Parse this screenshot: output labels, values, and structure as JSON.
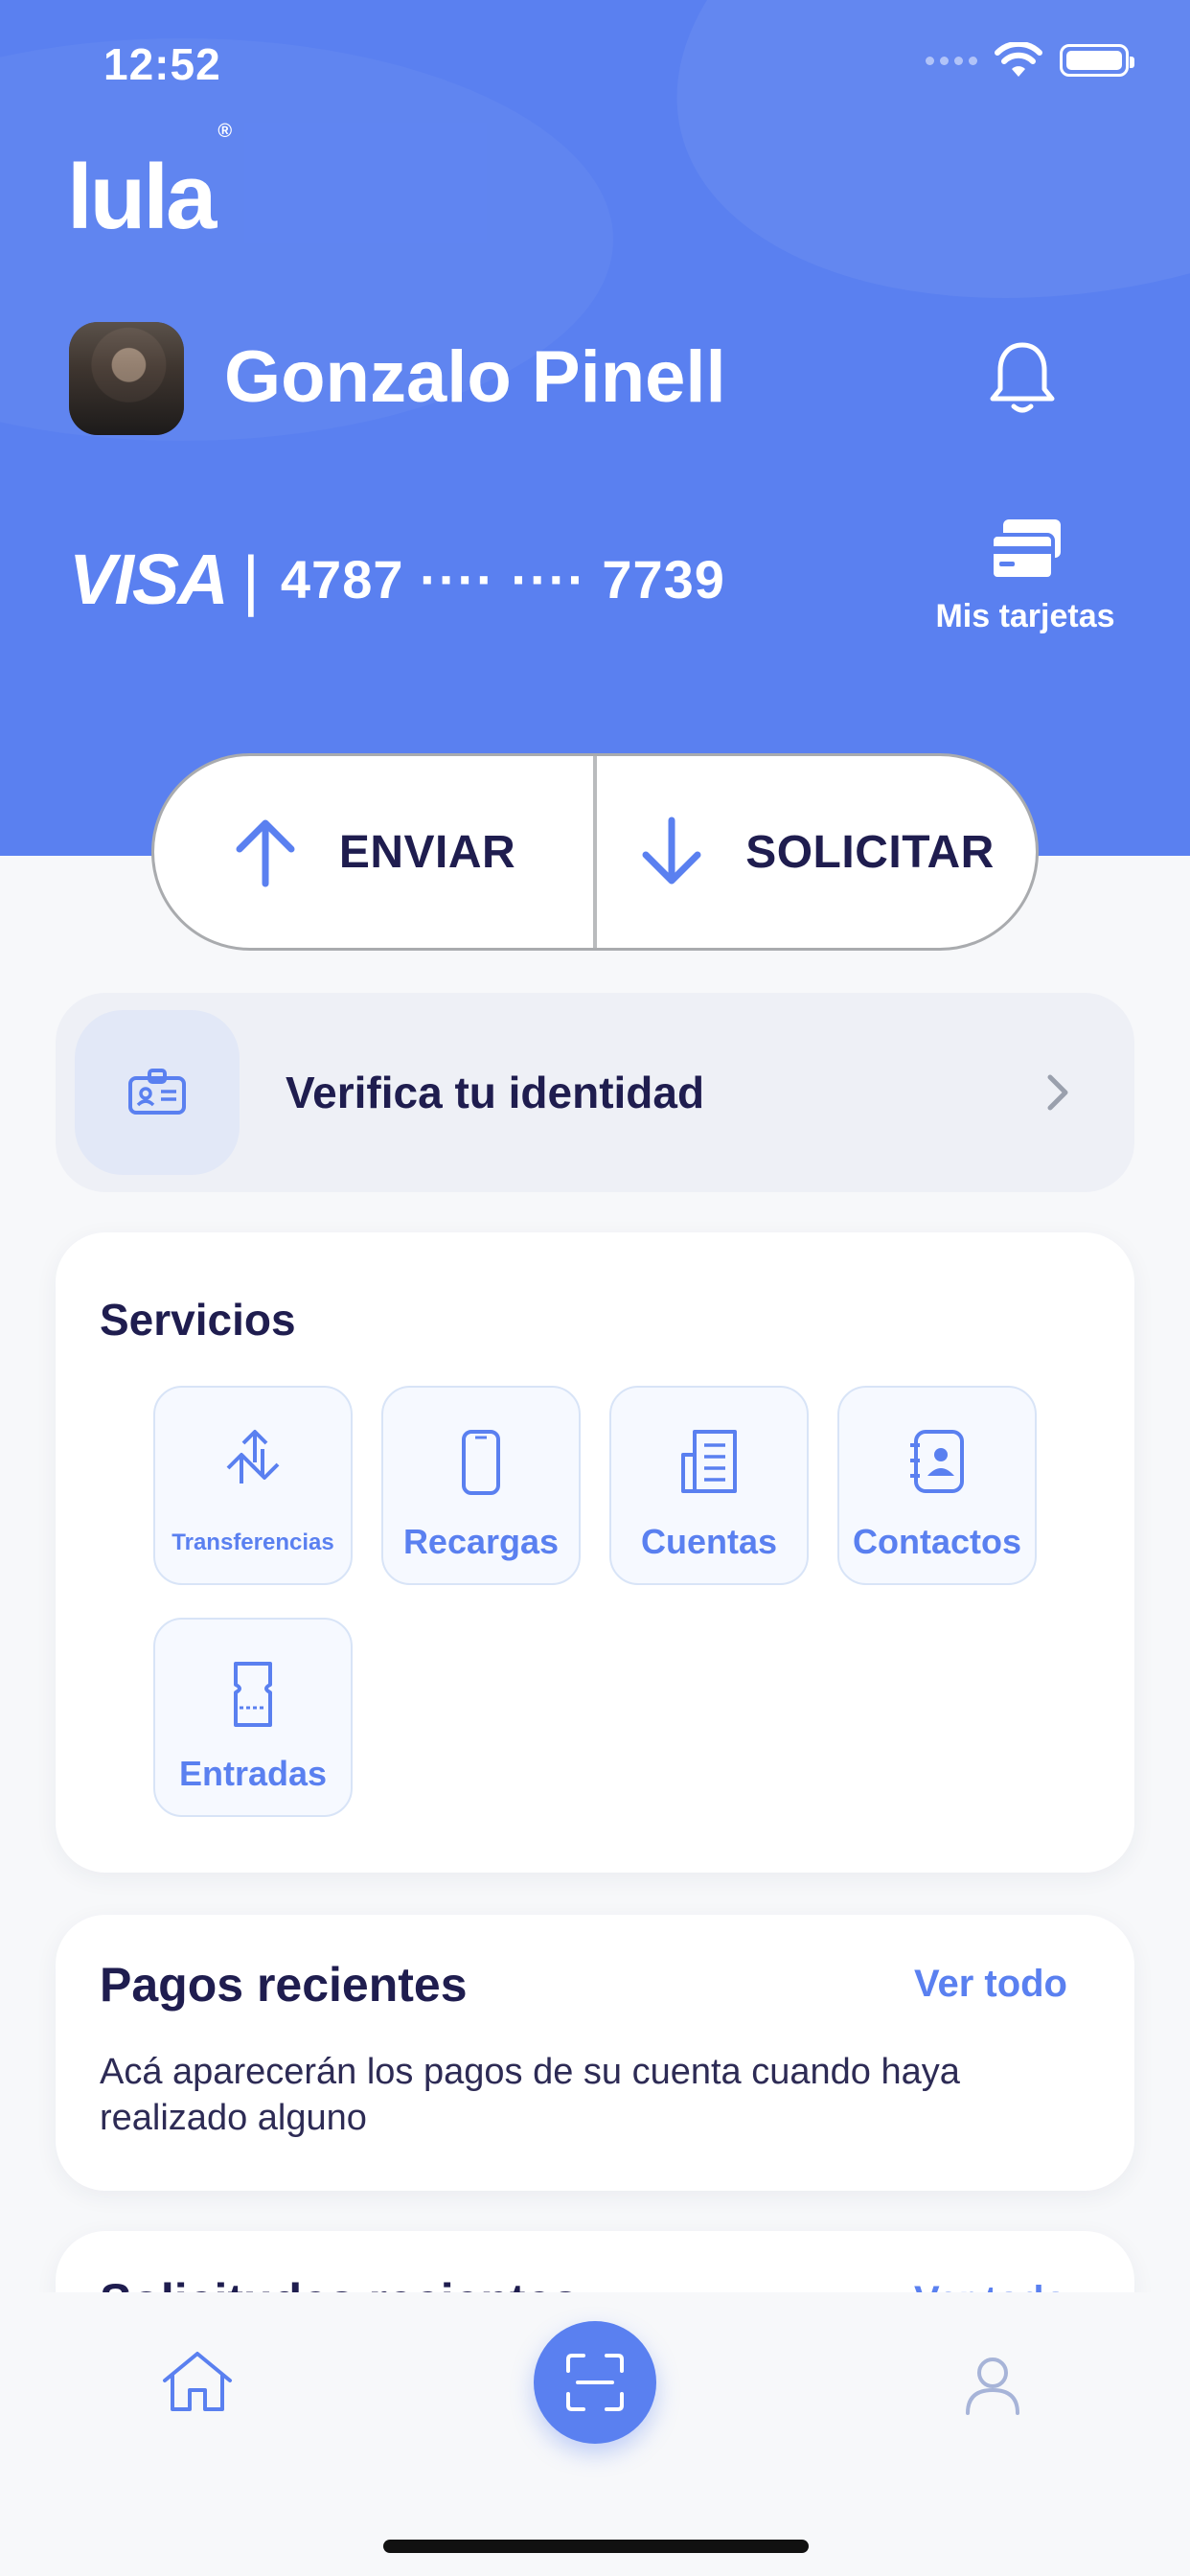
{
  "status_bar": {
    "time": "12:52"
  },
  "header": {
    "brand": "lula",
    "brand_mark": "®",
    "user_name": "Gonzalo Pinell",
    "notification_icon": "bell-icon"
  },
  "card": {
    "network": "VISA",
    "separator": "|",
    "number_masked": "4787 ···· ···· 7739",
    "my_cards_label": "Mis tarjetas",
    "my_cards_icon": "cards-icon"
  },
  "actions": {
    "send_label": "ENVIAR",
    "request_label": "SOLICITAR"
  },
  "verify": {
    "label": "Verifica tu identidad",
    "icon": "id-card-icon"
  },
  "services": {
    "title": "Servicios",
    "items": [
      {
        "label": "Transferencias",
        "icon": "transfer-icon"
      },
      {
        "label": "Recargas",
        "icon": "phone-icon"
      },
      {
        "label": "Cuentas",
        "icon": "bill-icon"
      },
      {
        "label": "Contactos",
        "icon": "contacts-icon"
      },
      {
        "label": "Entradas",
        "icon": "ticket-icon"
      }
    ]
  },
  "recent_payments": {
    "title": "Pagos recientes",
    "see_all": "Ver todo",
    "empty_message": "Acá aparecerán los pagos de su cuenta cuando haya realizado alguno"
  },
  "recent_requests": {
    "title": "Solicitudes recientes",
    "see_all": "Ver todo"
  },
  "colors": {
    "primary": "#5a80f0",
    "text_dark": "#1f1d4f",
    "background": "#f7f8fa"
  }
}
